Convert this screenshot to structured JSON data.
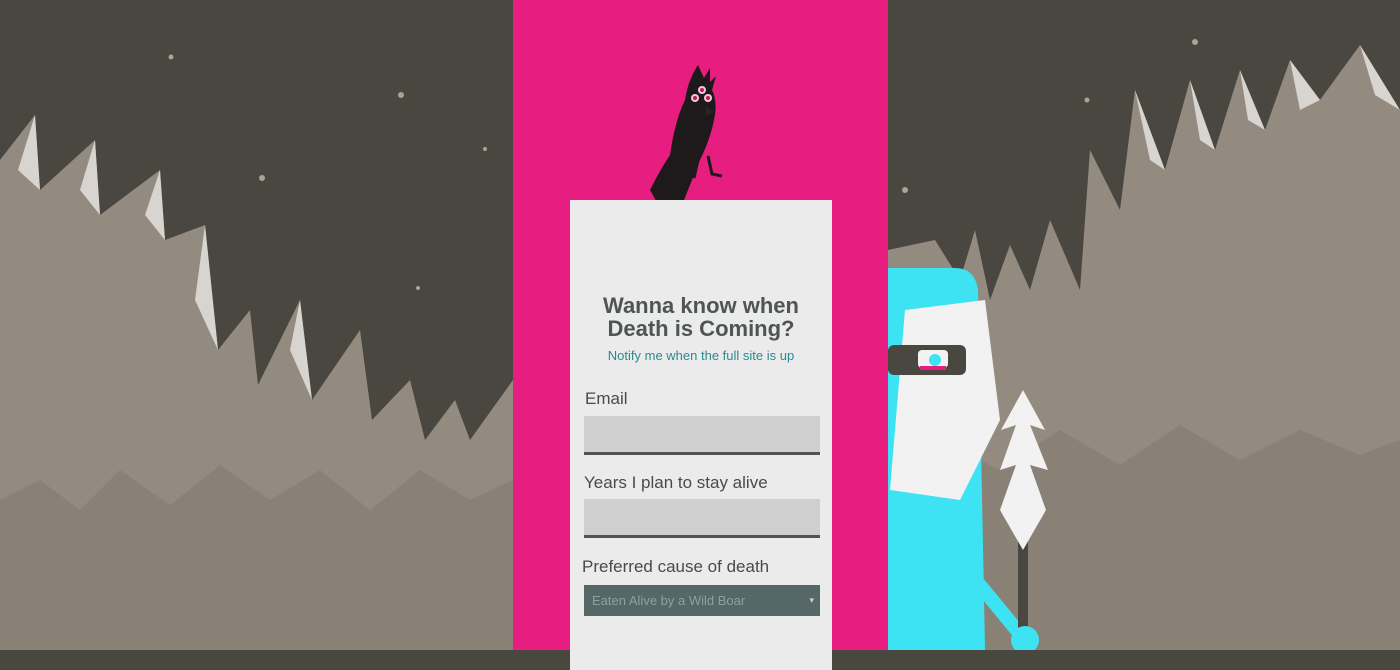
{
  "signup": {
    "title_line1": "Wanna know when",
    "title_line2": "Death is Coming?",
    "subtitle": "Notify me when the full site is up",
    "email_label": "Email",
    "years_label": "Years I plan to stay alive",
    "cause_label": "Preferred cause of death",
    "cause_selected": "Eaten Alive by a Wild Boar",
    "email_value": "",
    "years_value": ""
  },
  "colors": {
    "pink_band": "#e71d7f",
    "night_sky": "#4a4640",
    "mountain": "#948b80",
    "accent_teal": "#2a8a93",
    "character_cyan": "#3de3f2"
  },
  "decor": {
    "crow_icon": "crow-illustration",
    "character_icon": "masked-character-illustration"
  }
}
